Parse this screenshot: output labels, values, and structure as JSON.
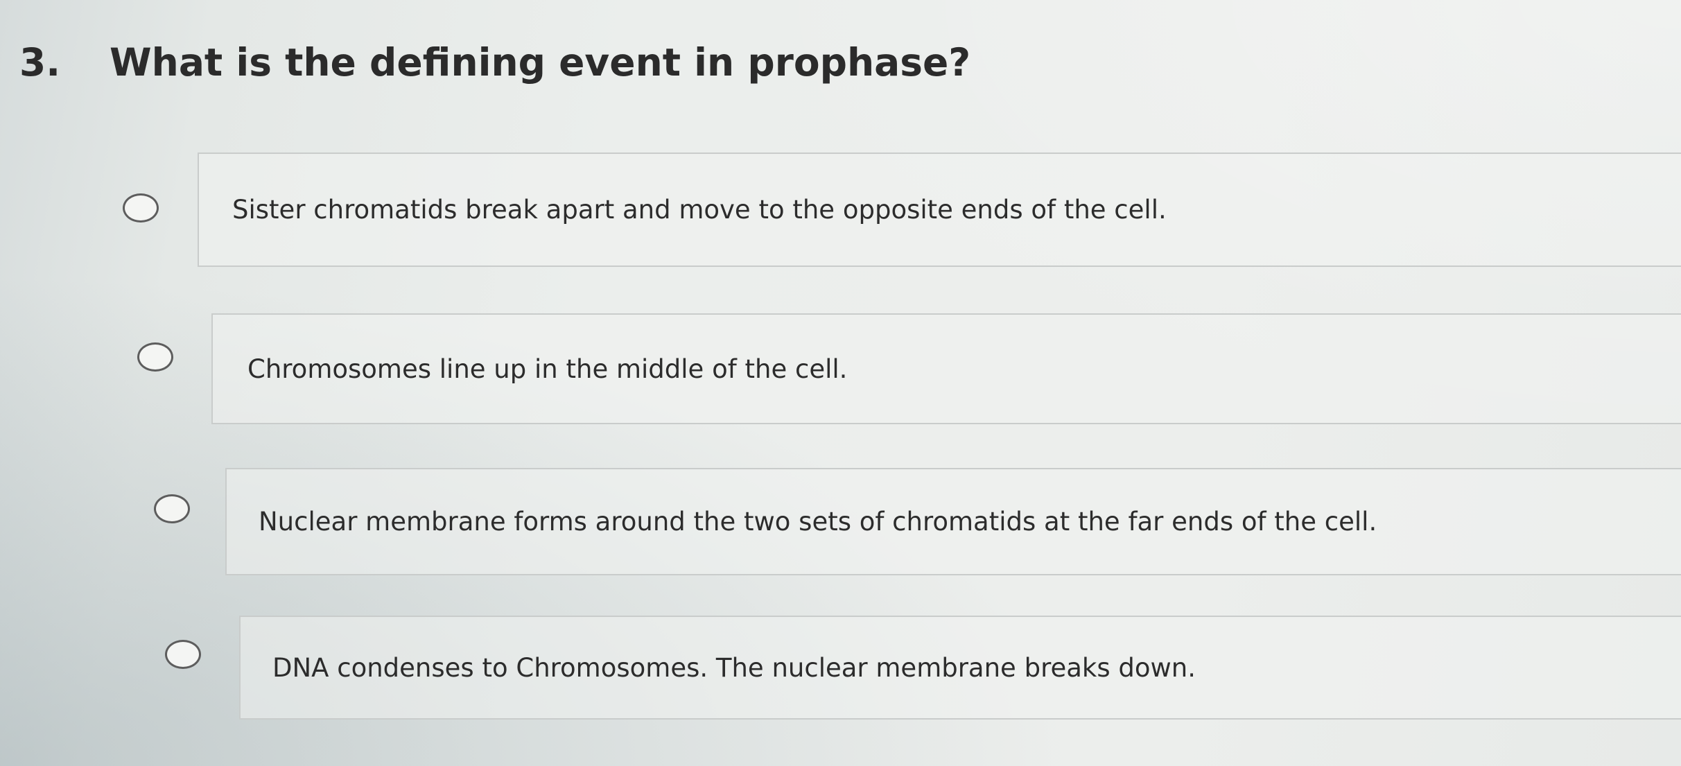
{
  "question": {
    "number": "3.",
    "text": "What is the defining event in prophase?"
  },
  "options": [
    {
      "label": "Sister chromatids break apart and move to the opposite ends of the cell.",
      "selected": false
    },
    {
      "label": "Chromosomes line up in the middle of the cell.",
      "selected": false
    },
    {
      "label": "Nuclear membrane forms around the two sets of chromatids at the far ends of the cell.",
      "selected": false
    },
    {
      "label": "DNA condenses to Chromosomes.  The nuclear membrane breaks down.",
      "selected": false
    }
  ]
}
